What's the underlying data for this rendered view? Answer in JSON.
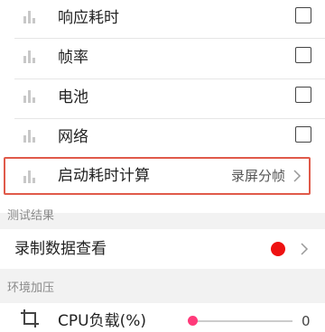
{
  "metrics": {
    "items": [
      {
        "label": "响应耗时",
        "checked": false,
        "icon": "bar-chart-icon"
      },
      {
        "label": "帧率",
        "checked": false,
        "icon": "bar-chart-icon"
      },
      {
        "label": "电池",
        "checked": false,
        "icon": "bar-chart-icon"
      },
      {
        "label": "网络",
        "checked": false,
        "icon": "bar-chart-icon"
      }
    ]
  },
  "startup": {
    "label": "启动耗时计算",
    "value": "录屏分帧",
    "icon": "bar-chart-icon",
    "highlight_color": "#e05a4a"
  },
  "test_results": {
    "header": "测试结果",
    "record_label": "录制数据查看",
    "record_indicator_color": "#ee1111"
  },
  "env_pressure": {
    "header": "环境加压",
    "cpu_label": "CPU负载(%)",
    "cpu_value": "0",
    "cpu_level": 0,
    "accent_color": "#ff3a7a",
    "icon": "crop-icon"
  }
}
